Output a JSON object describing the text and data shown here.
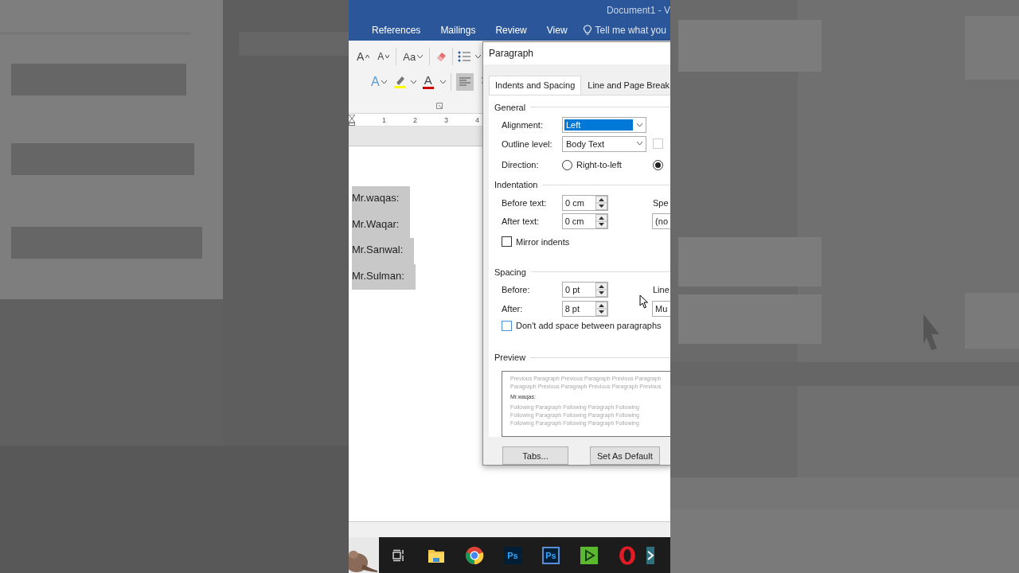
{
  "window": {
    "title": "Document1 - V"
  },
  "ribbon_tabs": [
    {
      "label": "References"
    },
    {
      "label": "Mailings"
    },
    {
      "label": "Review"
    },
    {
      "label": "View"
    }
  ],
  "tell_me": {
    "placeholder": "Tell me what you"
  },
  "ribbon": {
    "grow_font": "A",
    "shrink_font": "A",
    "change_case": "Aa",
    "text_effects": "A",
    "font_color": "A",
    "align_left_selected": true
  },
  "ruler": {
    "marks": [
      "1",
      "2",
      "3",
      "4"
    ]
  },
  "document": {
    "lines": [
      {
        "text": "Mr.waqas:",
        "selected": true
      },
      {
        "text": "Mr.Waqar:",
        "selected": true
      },
      {
        "text": "Mr.Sanwal:",
        "selected": true
      },
      {
        "text": "Mr.Sulman:",
        "selected": true
      }
    ]
  },
  "dialog": {
    "title": "Paragraph",
    "tabs": [
      {
        "label": "Indents and Spacing",
        "selected": true
      },
      {
        "label": "Line and Page Break",
        "selected": false
      }
    ],
    "general": {
      "heading": "General",
      "alignment": {
        "label": "Alignment:",
        "value": "Left",
        "selected": true
      },
      "outline": {
        "label": "Outline level:",
        "value": "Body Text"
      },
      "collapsed_checkbox": {
        "checked": false,
        "disabled": true
      },
      "direction": {
        "label": "Direction:",
        "options": [
          {
            "label": "Right-to-left",
            "checked": false
          },
          {
            "checked": true
          }
        ]
      }
    },
    "indentation": {
      "heading": "Indentation",
      "before": {
        "label": "Before text:",
        "value": "0 cm"
      },
      "after": {
        "label": "After text:",
        "value": "0 cm"
      },
      "special_label": "Spe",
      "special_value": "(no",
      "mirror": {
        "label": "Mirror indents",
        "checked": false
      }
    },
    "spacing": {
      "heading": "Spacing",
      "before": {
        "label": "Before:",
        "value": "0 pt"
      },
      "after": {
        "label": "After:",
        "value": "8 pt"
      },
      "line_label": "Line",
      "line_value": "Mu",
      "dont_add": {
        "label": "Don't add space between paragraphs",
        "checked": false
      }
    },
    "preview": {
      "heading": "Preview",
      "previous": [
        "Previous Paragraph Previous Paragraph Previous Paragraph",
        "Paragraph Previous Paragraph Previous Paragraph Previous"
      ],
      "sample": "Mr.waqas:",
      "following": [
        "Following Paragraph Following Paragraph Following",
        "Following Paragraph Following Paragraph Following",
        "Following Paragraph Following Paragraph Following"
      ]
    },
    "buttons": [
      {
        "label": "Tabs..."
      },
      {
        "label": "Set As Default"
      }
    ]
  },
  "taskbar": {
    "apps": [
      {
        "kind": "picture"
      },
      {
        "kind": "taskview"
      },
      {
        "kind": "folder"
      },
      {
        "kind": "chrome"
      },
      {
        "kind": "ps",
        "label": "Ps"
      },
      {
        "kind": "ps2",
        "label": "Ps"
      },
      {
        "kind": "play"
      },
      {
        "kind": "opera"
      },
      {
        "kind": "partial"
      }
    ]
  }
}
